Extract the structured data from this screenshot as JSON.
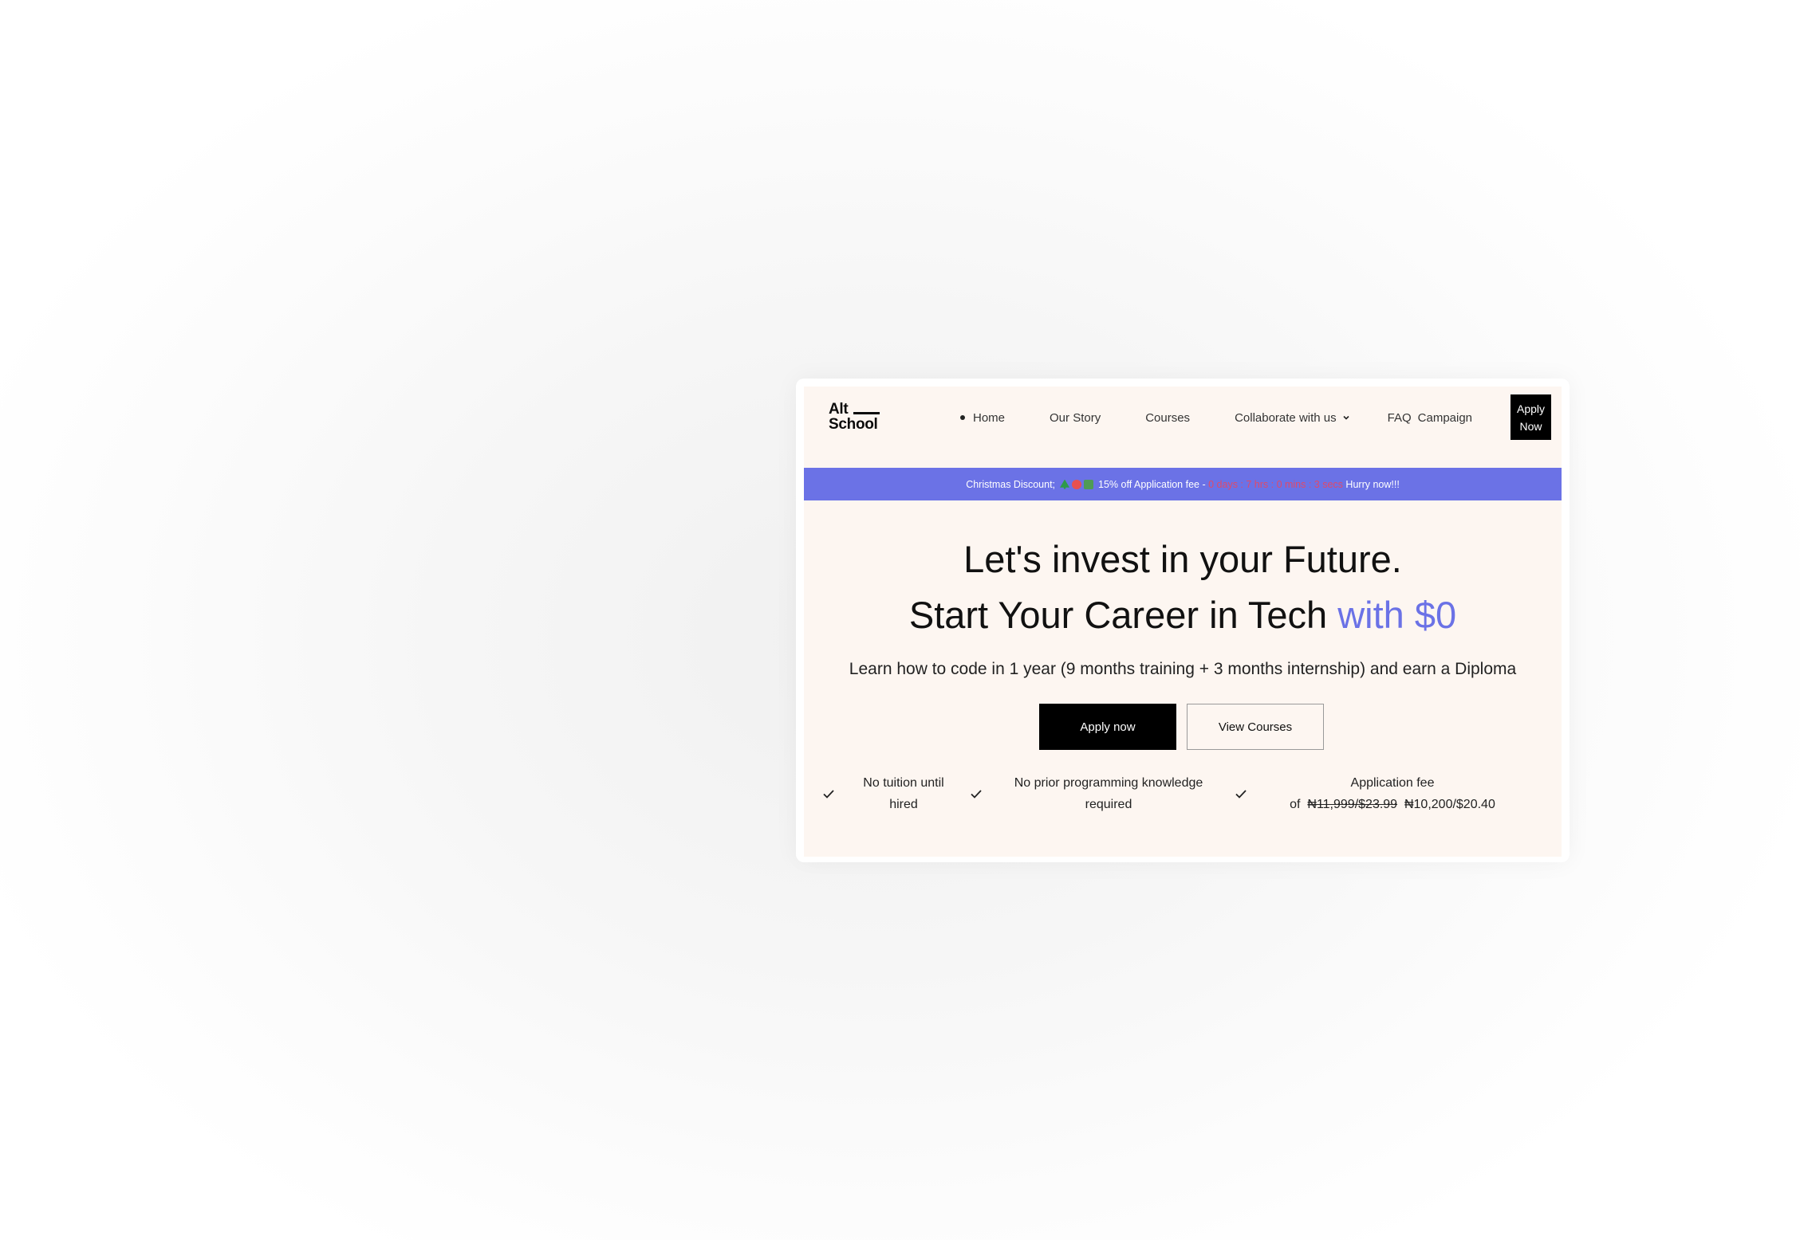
{
  "nav": {
    "logo_line1": "Alt",
    "logo_line2": "School",
    "links": [
      {
        "label": "Home"
      },
      {
        "label": "Our Story"
      },
      {
        "label": "Courses"
      },
      {
        "label": "Collaborate with us"
      },
      {
        "label": "FAQ"
      },
      {
        "label": "Campaign"
      }
    ],
    "apply_line1": "Apply",
    "apply_line2": "Now"
  },
  "banner": {
    "prefix": "Christmas Discount;",
    "emoji_icons": [
      "christmas-tree-icon",
      "santa-icon",
      "cactus-icon"
    ],
    "offer": "15% off Application fee -",
    "countdown": "0 days : 7 hrs : 0 mins : 3 secs",
    "cta": "Hurry now!!!"
  },
  "hero": {
    "line1": "Let's invest in your Future.",
    "line2_main": "Start Your Career in Tech",
    "line2_accent": "with $0",
    "subtitle": "Learn how to code in 1 year (9 months training + 3 months internship) and earn a Diploma",
    "primary_button": "Apply now",
    "secondary_button": "View Courses"
  },
  "features": [
    {
      "line1": "No tuition until",
      "line2": "hired"
    },
    {
      "line1": "No prior programming knowledge",
      "line2": "required"
    },
    {
      "line1": "Application fee",
      "line2_prefix": "of",
      "old_price": "₦11,999/$23.99",
      "new_price": "₦10,200/$20.40"
    }
  ],
  "colors": {
    "accent": "#6b72e6",
    "page_bg": "#fdf6f1",
    "primary_button": "#000000"
  }
}
